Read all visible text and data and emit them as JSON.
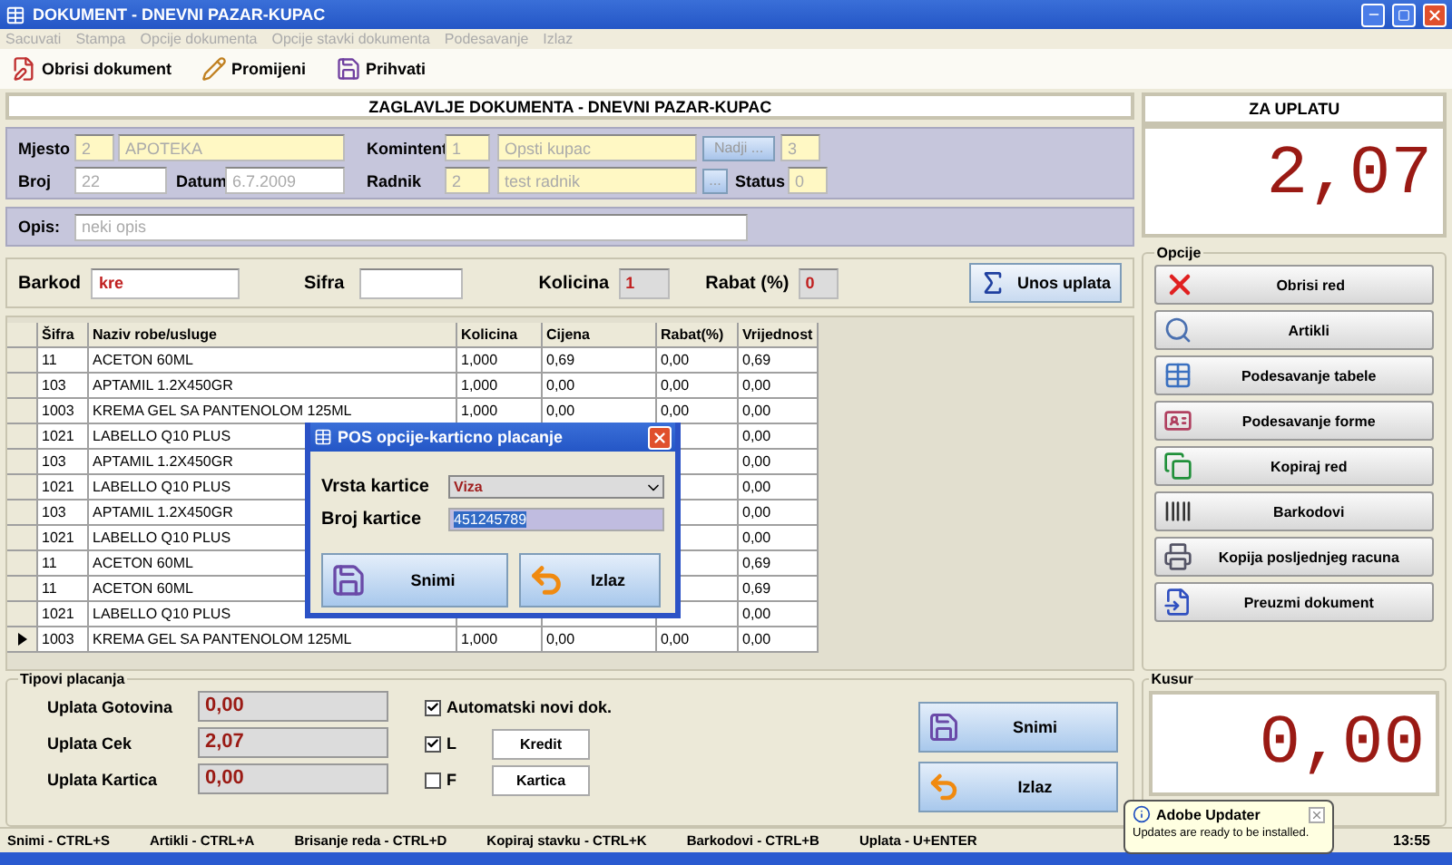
{
  "window": {
    "title": "DOKUMENT - DNEVNI PAZAR-KUPAC"
  },
  "menu": [
    {
      "label": "Sacuvati",
      "disabled": true
    },
    {
      "label": "Stampa",
      "disabled": true
    },
    {
      "label": "Opcije dokumenta",
      "disabled": true
    },
    {
      "label": "Opcije stavki dokumenta",
      "disabled": true
    },
    {
      "label": "Podesavanje",
      "disabled": true
    },
    {
      "label": "Izlaz",
      "disabled": true
    }
  ],
  "toolbar": [
    "Obrisi dokument",
    "Promijeni",
    "Prihvati"
  ],
  "header": {
    "title": "ZAGLAVLJE DOKUMENTA - DNEVNI PAZAR-KUPAC"
  },
  "document": {
    "mjesto": {
      "label": "Mjesto",
      "code": "2",
      "name": "APOTEKA"
    },
    "broj": {
      "label": "Broj",
      "value": "22"
    },
    "datum": {
      "label": "Datum",
      "value": "6.7.2009"
    },
    "komintent": {
      "label": "Komintent",
      "code": "1",
      "name": "Opsti kupac",
      "button": "Nadji ...",
      "extra": "3"
    },
    "radnik": {
      "label": "Radnik",
      "code": "2",
      "name": "test radnik",
      "button": "..."
    },
    "status": {
      "label": "Status",
      "value": "0"
    },
    "opis": {
      "label": "Opis:",
      "value": "neki opis"
    }
  },
  "entry": {
    "fields": [
      {
        "label": "Barkod",
        "value": "kre"
      },
      {
        "label": "Sifra"
      },
      {
        "label": "Kolicina",
        "value": "1"
      },
      {
        "label": "Rabat (%)",
        "value": "0"
      }
    ],
    "button": "Unos uplata"
  },
  "table": {
    "columns": [
      "Šifra",
      "Naziv robe/usluge",
      "Kolicina",
      "Cijena",
      "Rabat(%)",
      "Vrijednost"
    ],
    "rows": [
      {
        "selected": false,
        "cells": [
          "11",
          "ACETON 60ML",
          "1,000",
          "0,69",
          "0,00",
          "0,69"
        ]
      },
      {
        "selected": false,
        "cells": [
          "103",
          "APTAMIL 1.2X450GR",
          "1,000",
          "0,00",
          "0,00",
          "0,00"
        ]
      },
      {
        "selected": false,
        "cells": [
          "1003",
          "KREMA GEL SA PANTENOLOM 125ML",
          "1,000",
          "0,00",
          "0,00",
          "0,00"
        ]
      },
      {
        "selected": false,
        "cells": [
          "1021",
          "LABELLO Q10 PLUS",
          null,
          null,
          null,
          "0,00"
        ]
      },
      {
        "selected": false,
        "cells": [
          "103",
          "APTAMIL 1.2X450GR",
          null,
          null,
          null,
          "0,00"
        ]
      },
      {
        "selected": false,
        "cells": [
          "1021",
          "LABELLO Q10 PLUS",
          null,
          null,
          null,
          "0,00"
        ]
      },
      {
        "selected": false,
        "cells": [
          "103",
          "APTAMIL 1.2X450GR",
          null,
          null,
          null,
          "0,00"
        ]
      },
      {
        "selected": false,
        "cells": [
          "1021",
          "LABELLO Q10 PLUS",
          null,
          null,
          null,
          "0,00"
        ]
      },
      {
        "selected": false,
        "cells": [
          "11",
          "ACETON 60ML",
          null,
          null,
          null,
          "0,69"
        ]
      },
      {
        "selected": false,
        "cells": [
          "11",
          "ACETON 60ML",
          null,
          null,
          null,
          "0,69"
        ]
      },
      {
        "selected": false,
        "cells": [
          "1021",
          "LABELLO Q10 PLUS",
          null,
          null,
          null,
          "0,00"
        ]
      },
      {
        "selected": true,
        "cells": [
          "1003",
          "KREMA GEL SA PANTENOLOM 125ML",
          "1,000",
          "0,00",
          "0,00",
          "0,00"
        ]
      }
    ]
  },
  "dialog": {
    "title": "POS opcije-karticno placanje",
    "card_type": {
      "label": "Vrsta kartice",
      "value": "Viza"
    },
    "card_number": {
      "label": "Broj kartice",
      "value": "451245789"
    },
    "buttons": [
      "Snimi",
      "Izlaz"
    ]
  },
  "summary": {
    "title": "ZA UPLATU",
    "amount": "2,07"
  },
  "options": {
    "title": "Opcije",
    "buttons": [
      "Obrisi red",
      "Artikli",
      "Podesavanje tabele",
      "Podesavanje forme",
      "Kopiraj red",
      "Barkodovi",
      "Kopija posljednjeg racuna",
      "Preuzmi dokument"
    ]
  },
  "payments": {
    "title": "Tipovi placanja",
    "rows": [
      {
        "label": "Uplata Gotovina",
        "value": "0,00"
      },
      {
        "label": "Uplata Cek",
        "value": "2,07"
      },
      {
        "label": "Uplata Kartica",
        "value": "0,00"
      }
    ],
    "auto": {
      "label": "Automatski novi dok.",
      "checked": true
    },
    "flags": [
      {
        "label": "L",
        "checked": true,
        "button": "Kredit"
      },
      {
        "label": "F",
        "checked": false,
        "button": "Kartica"
      }
    ],
    "buttons": [
      "Snimi",
      "Izlaz"
    ]
  },
  "change": {
    "title": "Kusur",
    "amount": "0,00"
  },
  "status_bar": {
    "shortcuts": [
      "Snimi - CTRL+S",
      "Artikli - CTRL+A",
      "Brisanje reda  - CTRL+D",
      "Kopiraj stavku  - CTRL+K",
      "Barkodovi - CTRL+B",
      "Uplata - U+ENTER"
    ],
    "clock": "13:55"
  },
  "notification": {
    "title": "Adobe Updater",
    "message": "Updates are ready to be installed."
  }
}
